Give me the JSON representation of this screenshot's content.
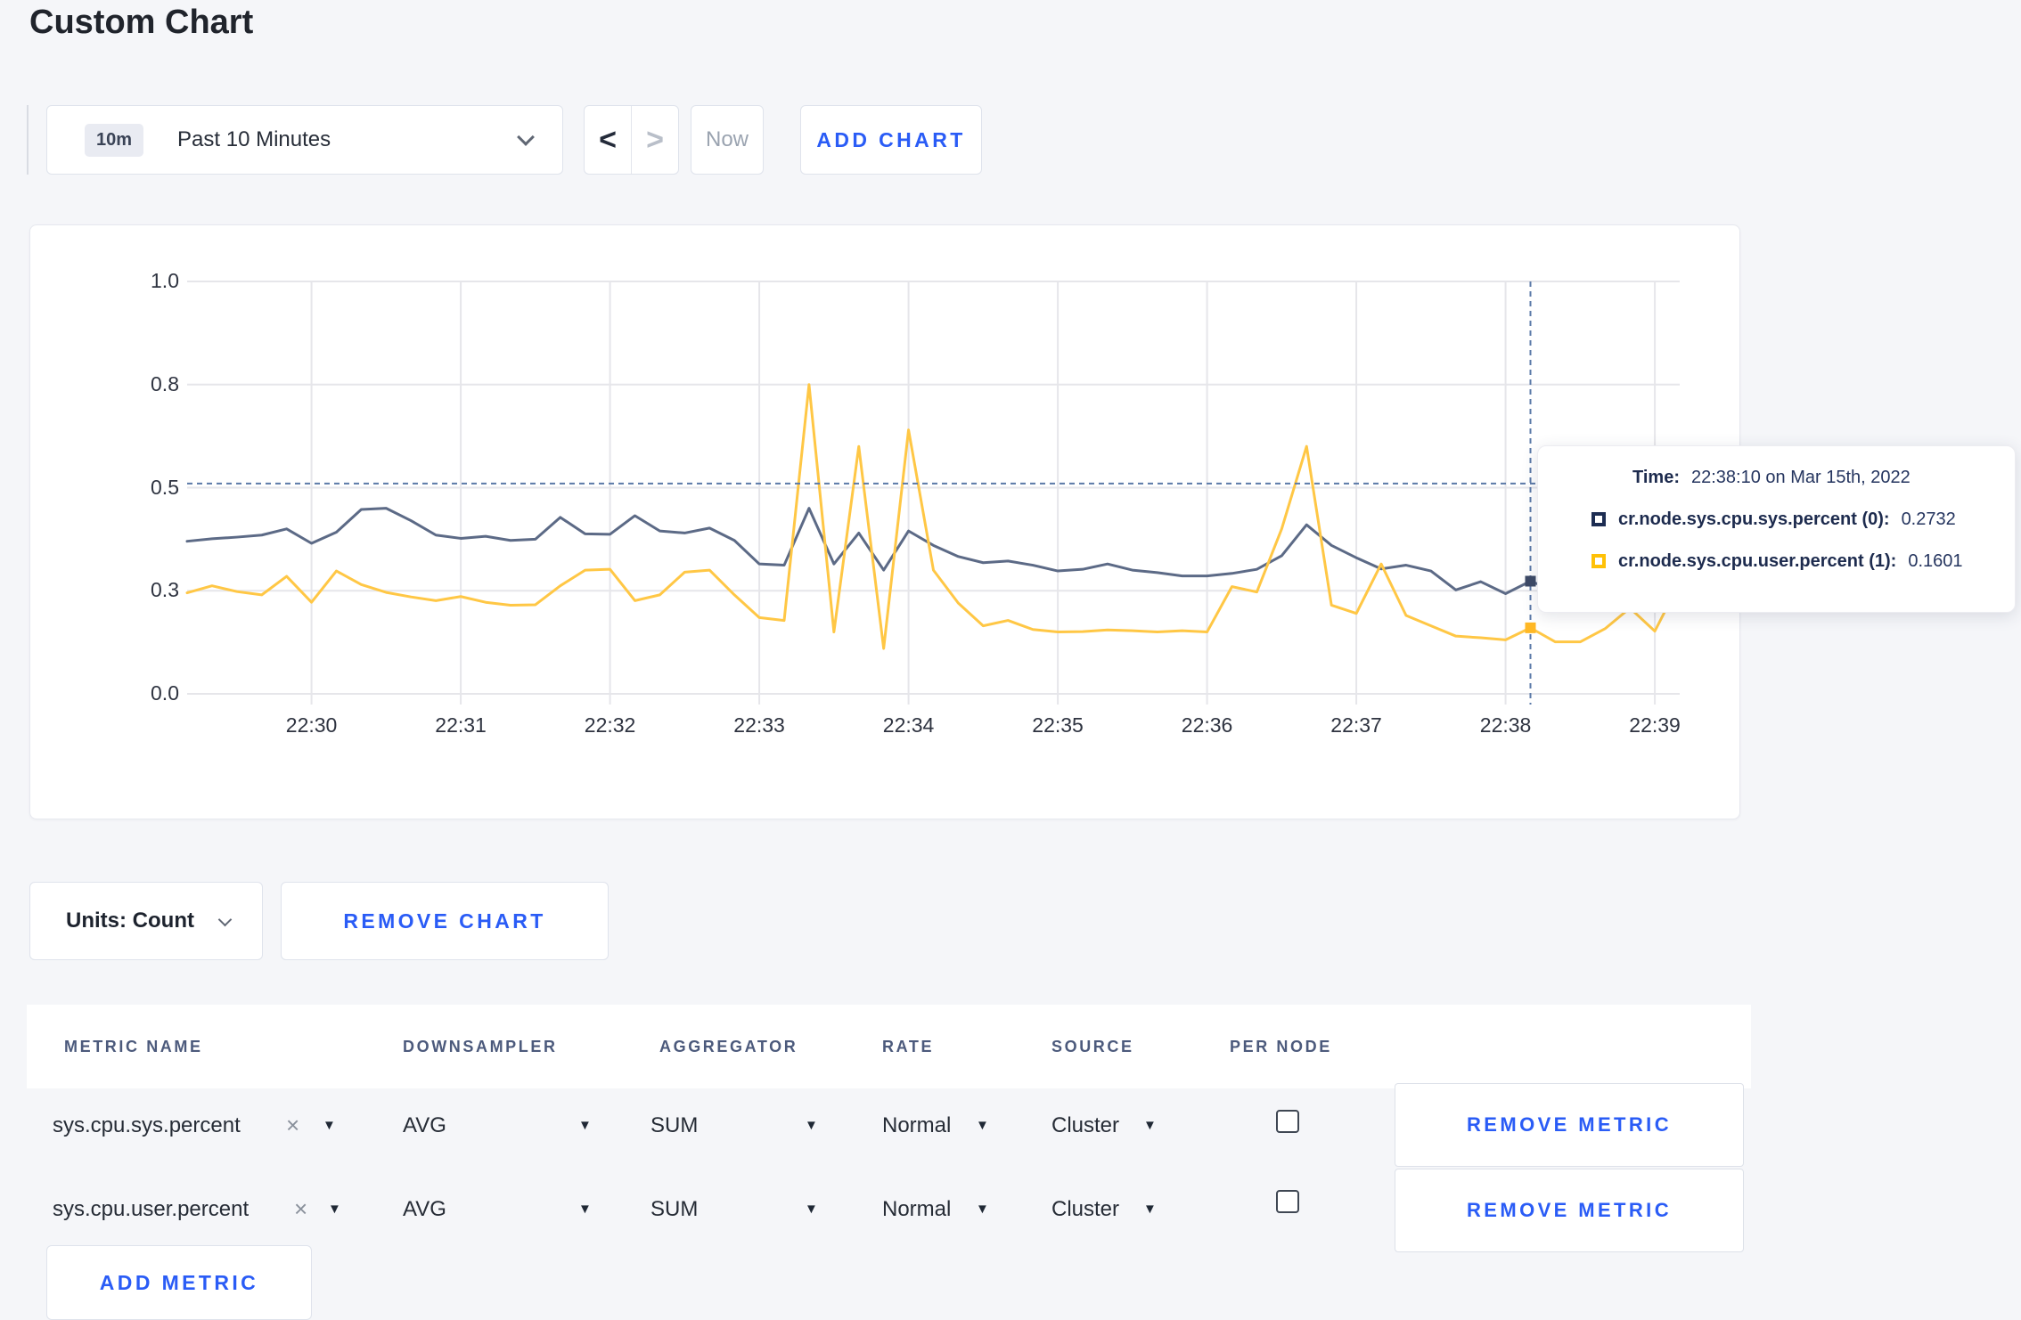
{
  "page": {
    "title": "Custom Chart",
    "background": "#f5f6f9"
  },
  "toolbar": {
    "time_badge": "10m",
    "time_label": "Past 10 Minutes",
    "prev_glyph": "<",
    "next_glyph": ">",
    "now_label": "Now",
    "add_chart_label": "ADD CHART"
  },
  "colors": {
    "accent_blue": "#2a5cf6",
    "series_sys": "#5c6a86",
    "series_user": "#ffc745",
    "legend_sys_square": "#1d2d52",
    "legend_user_square": "#ffc107",
    "gridline": "#e6e6ea",
    "crosshair": "#5b79a8"
  },
  "chart_data": {
    "type": "line",
    "x_start": "22:29:10",
    "x_end": "22:39:10",
    "interval_seconds": 10,
    "x_tick_labels": [
      "22:30",
      "22:31",
      "22:32",
      "22:33",
      "22:34",
      "22:35",
      "22:36",
      "22:37",
      "22:38",
      "22:39"
    ],
    "y_tick_labels": [
      "1.0",
      "0.8",
      "0.5",
      "0.3",
      "0.0"
    ],
    "y_tick_values": [
      1.0,
      0.75,
      0.5,
      0.25,
      0.0
    ],
    "ylim": [
      0,
      1
    ],
    "grid": true,
    "crosshair": {
      "time": "22:38:10",
      "y_value": 0.51
    },
    "series": [
      {
        "name": "cr.node.sys.cpu.sys.percent (0)",
        "color": "#5c6a86",
        "values": [
          0.37,
          0.376,
          0.38,
          0.385,
          0.4,
          0.365,
          0.392,
          0.447,
          0.45,
          0.42,
          0.385,
          0.377,
          0.382,
          0.372,
          0.375,
          0.428,
          0.388,
          0.387,
          0.432,
          0.395,
          0.39,
          0.402,
          0.372,
          0.315,
          0.312,
          0.45,
          0.315,
          0.39,
          0.3,
          0.395,
          0.36,
          0.333,
          0.318,
          0.322,
          0.312,
          0.298,
          0.302,
          0.315,
          0.3,
          0.294,
          0.286,
          0.286,
          0.292,
          0.302,
          0.335,
          0.41,
          0.36,
          0.33,
          0.303,
          0.312,
          0.298,
          0.252,
          0.272,
          0.243,
          0.2732,
          0.25,
          0.268,
          0.283,
          0.275,
          0.28,
          0.298
        ]
      },
      {
        "name": "cr.node.sys.cpu.user.percent (1)",
        "color": "#ffc745",
        "values": [
          0.245,
          0.262,
          0.248,
          0.24,
          0.285,
          0.222,
          0.298,
          0.265,
          0.246,
          0.235,
          0.226,
          0.236,
          0.222,
          0.215,
          0.216,
          0.262,
          0.3,
          0.302,
          0.226,
          0.24,
          0.295,
          0.3,
          0.24,
          0.185,
          0.178,
          0.75,
          0.15,
          0.6,
          0.11,
          0.64,
          0.3,
          0.22,
          0.165,
          0.178,
          0.156,
          0.15,
          0.151,
          0.155,
          0.153,
          0.15,
          0.153,
          0.15,
          0.26,
          0.247,
          0.4,
          0.6,
          0.215,
          0.195,
          0.315,
          0.19,
          0.165,
          0.14,
          0.136,
          0.131,
          0.1601,
          0.126,
          0.126,
          0.158,
          0.208,
          0.152,
          0.27
        ]
      }
    ]
  },
  "tooltip": {
    "time_label": "Time:",
    "time_value": "22:38:10 on Mar 15th, 2022",
    "series": [
      {
        "label": "cr.node.sys.cpu.sys.percent (0):",
        "value": "0.2732",
        "square_color": "#1d2d52"
      },
      {
        "label": "cr.node.sys.cpu.user.percent (1):",
        "value": "0.1601",
        "square_color": "#ffc107"
      }
    ]
  },
  "chart_controls": {
    "units_label": "Units: Count",
    "remove_chart_label": "REMOVE CHART"
  },
  "metrics_table": {
    "headers": [
      "METRIC NAME",
      "DOWNSAMPLER",
      "AGGREGATOR",
      "RATE",
      "SOURCE",
      "PER NODE"
    ],
    "rows": [
      {
        "metric_name": "sys.cpu.sys.percent",
        "downsampler": "AVG",
        "aggregator": "SUM",
        "rate": "Normal",
        "source": "Cluster",
        "per_node_checked": false,
        "remove_label": "REMOVE METRIC"
      },
      {
        "metric_name": "sys.cpu.user.percent",
        "downsampler": "AVG",
        "aggregator": "SUM",
        "rate": "Normal",
        "source": "Cluster",
        "per_node_checked": false,
        "remove_label": "REMOVE METRIC"
      }
    ],
    "add_metric_label": "ADD METRIC"
  },
  "glyphs": {
    "close": "×",
    "caret_down": "▼"
  }
}
